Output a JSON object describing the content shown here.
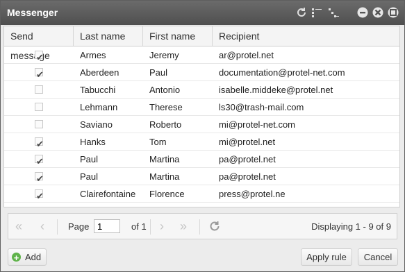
{
  "window": {
    "title": "Messenger"
  },
  "colors": {
    "titlebar": "#555555",
    "accent_green": "#5fb34a"
  },
  "icons": [
    "refresh-icon",
    "expand-icon",
    "collapse-icon",
    "minimize-icon",
    "restore-icon",
    "close-icon"
  ],
  "grid": {
    "columns": [
      "Send message",
      "Last name",
      "First name",
      "Recipient"
    ],
    "rows": [
      {
        "send": true,
        "last": "Armes",
        "first": "Jeremy",
        "recipient": "ar@protel.net"
      },
      {
        "send": true,
        "last": "Aberdeen",
        "first": "Paul",
        "recipient": "documentation@protel-net.com"
      },
      {
        "send": false,
        "last": "Tabucchi",
        "first": "Antonio",
        "recipient": "isabelle.middeke@protel.net"
      },
      {
        "send": false,
        "last": "Lehmann",
        "first": "Therese",
        "recipient": "ls30@trash-mail.com"
      },
      {
        "send": false,
        "last": "Saviano",
        "first": "Roberto",
        "recipient": "mi@protel-net.com"
      },
      {
        "send": true,
        "last": "Hanks",
        "first": "Tom",
        "recipient": "mi@protel.net"
      },
      {
        "send": true,
        "last": "Paul",
        "first": "Martina",
        "recipient": "pa@protel.net"
      },
      {
        "send": true,
        "last": "Paul",
        "first": "Martina",
        "recipient": "pa@protel.net"
      },
      {
        "send": true,
        "last": "Clairefontaine",
        "first": "Florence",
        "recipient": "press@protel.ne"
      }
    ]
  },
  "pager": {
    "page_label": "Page",
    "page_value": "1",
    "of_label": "of 1",
    "display_text": "Displaying 1 - 9 of 9"
  },
  "buttons": {
    "add": "Add",
    "apply_rule": "Apply rule",
    "cancel": "Cancel"
  }
}
